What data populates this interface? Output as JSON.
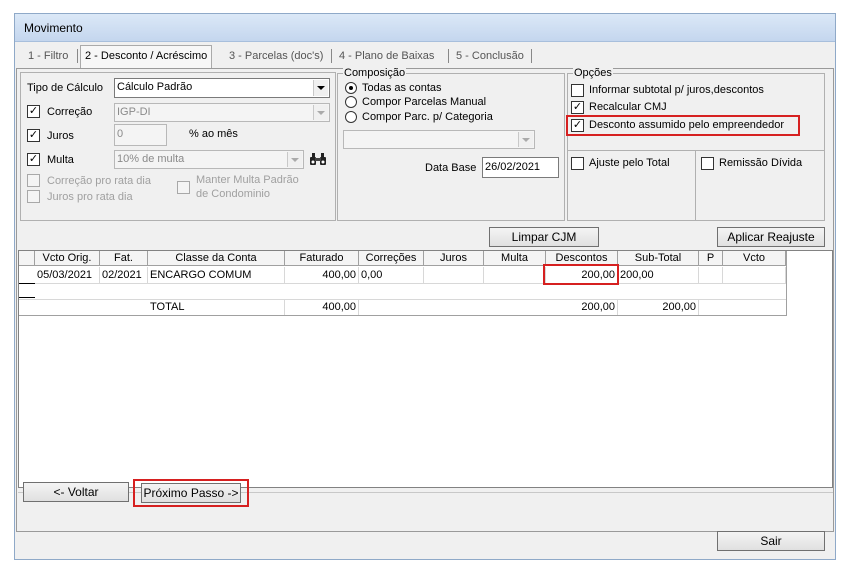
{
  "window": {
    "title": "Movimento"
  },
  "tabs": [
    {
      "label": "1 - Filtro"
    },
    {
      "label": "2 - Desconto / Acréscimo"
    },
    {
      "label": "3 - Parcelas (doc's)"
    },
    {
      "label": "4 - Plano de Baixas"
    },
    {
      "label": "5 - Conclusão"
    }
  ],
  "calc": {
    "tipo_label": "Tipo de Cálculo",
    "tipo_value": "Cálculo Padrão",
    "correcao_label": "Correção",
    "correcao_value": "IGP-DI",
    "juros_label": "Juros",
    "juros_value": "0",
    "juros_unit": "% ao mês",
    "multa_label": "Multa",
    "multa_value": "10% de multa",
    "correcao_pro_rata": "Correção pro rata dia",
    "juros_pro_rata": "Juros pro rata dia",
    "manter_multa_1": "Manter Multa Padrão",
    "manter_multa_2": "de Condominio"
  },
  "composicao": {
    "title": "Composição",
    "options": [
      "Todas as contas",
      "Compor Parcelas Manual",
      "Compor Parc. p/ Categoria"
    ],
    "data_base_label": "Data Base",
    "data_base_value": "26/02/2021"
  },
  "opcoes": {
    "title": "Opções",
    "items": [
      {
        "label": "Informar subtotal p/ juros,descontos",
        "checked": false
      },
      {
        "label": "Recalcular CMJ",
        "checked": true
      },
      {
        "label": "Desconto assumido pelo empreendedor",
        "checked": true
      }
    ],
    "ajuste_label": "Ajuste pelo Total",
    "remissao_label": "Remissão Dívida"
  },
  "buttons": {
    "limpar": "Limpar CJM",
    "aplicar": "Aplicar Reajuste",
    "voltar": "<- Voltar",
    "proximo": "Próximo Passo ->",
    "sair": "Sair"
  },
  "table": {
    "headers": [
      "Vcto Orig.",
      "Fat.",
      "Classe da Conta",
      "Faturado",
      "Correções",
      "Juros",
      "Multa",
      "Descontos",
      "Sub-Total",
      "P",
      "Vcto"
    ],
    "rows": [
      {
        "vcto_orig": "05/03/2021",
        "fat": "02/2021",
        "classe": "ENCARGO COMUM",
        "faturado": "400,00",
        "correcoes": "0,00",
        "juros": "",
        "multa": "",
        "descontos": "200,00",
        "subtotal": "200,00",
        "p": "",
        "vcto": ""
      }
    ],
    "total": {
      "label": "TOTAL",
      "faturado": "400,00",
      "descontos": "200,00",
      "subtotal": "200,00"
    }
  }
}
